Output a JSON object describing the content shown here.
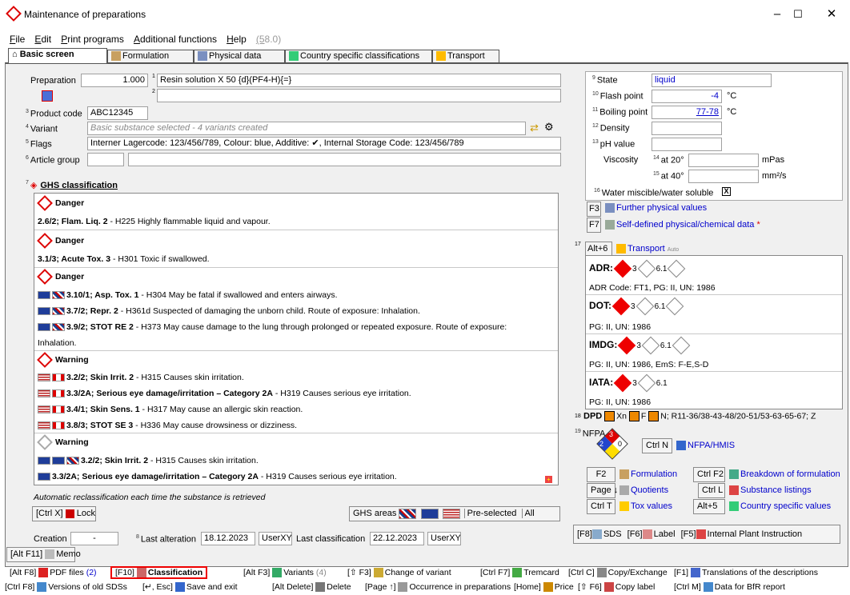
{
  "window": {
    "title": "Maintenance of preparations",
    "min": "–",
    "max": "☐",
    "close": "✕"
  },
  "menu": {
    "items": [
      "File",
      "Edit",
      "Print programs",
      "Additional functions",
      "Help"
    ],
    "version": "(58.0)"
  },
  "tabs": [
    "Basic screen",
    "Formulation",
    "Physical data",
    "Country specific classifications",
    "Transport"
  ],
  "form": {
    "preparation_label": "Preparation",
    "preparation_value": "1.000",
    "name1": "Resin solution X 50 {d}(PF4-H){=}",
    "name2": "",
    "product_code_label": "Product code",
    "product_code": "ABC12345",
    "variant_label": "Variant",
    "variant_value": "Basic substance selected - 4 variants created",
    "flags_label": "Flags",
    "flags_value": "Interner Lagercode: 123/456/789, Colour: blue, Additive: ✔, Internal Storage Code: 123/456/789",
    "article_group_label": "Article group",
    "ghs_heading": "GHS classification",
    "auto_reclass": "Automatic reclassification each time the substance is retrieved",
    "lock_shortcut": "[Ctrl X]",
    "lock_label": "Lock",
    "ghs_areas": "GHS areas",
    "preselected": "Pre-selected",
    "all": "All",
    "creation_label": "Creation",
    "creation_value": "-",
    "last_alteration_label": "Last alteration",
    "last_alteration_date": "18.12.2023",
    "last_alteration_user": "UserXY",
    "last_classification_label": "Last classification",
    "last_classification_date": "22.12.2023",
    "last_classification_user": "UserXY",
    "memo_shortcut": "[Alt F11]",
    "memo_label": "Memo"
  },
  "ghs": [
    {
      "signal": "Danger",
      "lines": [
        {
          "flags": [],
          "code": "2.6/2; Flam. Liq. 2",
          "text": " - H225 Highly flammable liquid and vapour."
        }
      ]
    },
    {
      "signal": "Danger",
      "lines": [
        {
          "flags": [],
          "code": "3.1/3; Acute Tox. 3",
          "text": " - H301 Toxic if swallowed."
        }
      ]
    },
    {
      "signal": "Danger",
      "lines": [
        {
          "flags": [
            "eu",
            "uk"
          ],
          "code": "3.10/1; Asp. Tox. 1",
          "text": " - H304 May be fatal if swallowed and enters airways."
        },
        {
          "flags": [
            "eu",
            "uk"
          ],
          "code": "3.7/2; Repr. 2",
          "text": " - H361d Suspected of damaging the unborn child. Route of exposure: Inhalation."
        },
        {
          "flags": [
            "eu",
            "uk"
          ],
          "code": "3.9/2; STOT RE 2",
          "text": " - H373 May cause damage to the lung through prolonged or repeated exposure. Route of exposure:"
        },
        {
          "flags": [],
          "code": "",
          "text": "Inhalation."
        }
      ]
    },
    {
      "signal": "Warning",
      "lines": [
        {
          "flags": [
            "us",
            "ca"
          ],
          "code": "3.2/2; Skin Irrit. 2",
          "text": " - H315 Causes skin irritation."
        },
        {
          "flags": [
            "us",
            "ca"
          ],
          "code": "3.3/2A; Serious eye damage/irritation – Category 2A",
          "text": " - H319 Causes serious eye irritation."
        },
        {
          "flags": [
            "us",
            "ca"
          ],
          "code": "3.4/1; Skin Sens. 1",
          "text": " - H317 May cause an allergic skin reaction."
        },
        {
          "flags": [
            "us",
            "ca"
          ],
          "code": "3.8/3; STOT SE 3",
          "text": " - H336 May cause drowsiness or dizziness."
        }
      ]
    },
    {
      "signal": "Warning",
      "lines": [
        {
          "flags": [
            "eu",
            "eu",
            "uk"
          ],
          "code": "3.2/2; Skin Irrit. 2",
          "text": " - H315 Causes skin irritation."
        },
        {
          "flags": [
            "eu"
          ],
          "code": "3.3/2A; Serious eye damage/irritation – Category 2A",
          "text": " - H319 Causes serious eye irritation."
        }
      ]
    }
  ],
  "physical": {
    "state_label": "State",
    "state": "liquid",
    "flash_label": "Flash point",
    "flash": "-4",
    "flash_unit": "°C",
    "boiling_label": "Boiling point",
    "boiling": "77-78",
    "boiling_unit": "°C",
    "density_label": "Density",
    "ph_label": "pH value",
    "viscosity_label": "Viscosity",
    "at20": "at 20°",
    "unit20": "mPas",
    "at40": "at 40°",
    "unit40": "mm²/s",
    "miscible_label": "Water miscible/water soluble",
    "miscible_mark": "X",
    "f3": "F3",
    "further": "Further physical values",
    "f7": "F7",
    "selfdefined": "Self-defined physical/chemical data",
    "asterisk": "*"
  },
  "transport": {
    "shortcut": "Alt+6",
    "label": "Transport",
    "auto": "Auto",
    "rows": [
      {
        "name": "ADR:",
        "n1": "3",
        "n2": "6.1",
        "detail": "ADR Code: FT1, PG: II, UN: 1986"
      },
      {
        "name": "DOT:",
        "n1": "3",
        "n2": "6.1",
        "detail": "PG: II, UN: 1986"
      },
      {
        "name": "IMDG:",
        "n1": "3",
        "n2": "6.1",
        "detail": "PG: II, UN: 1986, EmS: F-E,S-D"
      },
      {
        "name": "IATA:",
        "n1": "3",
        "n2": "6.1",
        "detail": "PG: II, UN: 1986"
      }
    ],
    "dpd_label": "DPD",
    "dpd_xn": "Xn",
    "dpd_f": "F",
    "dpd_text": "N; R11-36/38-43-48/20-51/53-63-65-67; Z",
    "nfpa_label": "NFPA",
    "nfpa_health": "2",
    "nfpa_fire": "3",
    "nfpa_react": "0",
    "nfpa_shortcut": "Ctrl N",
    "nfpa_link": "NFPA/HMIS"
  },
  "shortcuts": [
    {
      "key": "F2",
      "label": "Formulation"
    },
    {
      "key": "Ctrl F2",
      "label": "Breakdown of formulation"
    },
    {
      "key": "Page ↓",
      "label": "Quotients"
    },
    {
      "key": "Ctrl L",
      "label": "Substance listings"
    },
    {
      "key": "Ctrl T",
      "label": "Tox values"
    },
    {
      "key": "Alt+5",
      "label": "Country specific values"
    }
  ],
  "docs": {
    "sds_key": "[F8]",
    "sds": "SDS",
    "label_key": "[F6]",
    "label": "Label",
    "plant_key": "[F5]",
    "plant": "Internal Plant Instruction"
  },
  "bottom1": [
    {
      "key": "[Alt F8]",
      "label": "PDF files",
      "count": "(2)"
    },
    {
      "key": "[F10]",
      "label": "Classification",
      "count": ""
    },
    {
      "key": "[Alt F3]",
      "label": "Variants",
      "count": "(4)"
    },
    {
      "key": "[⇧ F3]",
      "label": "Change of variant",
      "count": ""
    },
    {
      "key": "[Ctrl F7]",
      "label": "Tremcard",
      "count": ""
    },
    {
      "key": "[Ctrl C]",
      "label": "Copy/Exchange",
      "count": ""
    },
    {
      "key": "[F1]",
      "label": "Translations of the descriptions",
      "count": ""
    }
  ],
  "bottom2": [
    {
      "key": "[Ctrl F8]",
      "label": "Versions of old SDSs"
    },
    {
      "key": "[↵, Esc]",
      "label": "Save and exit"
    },
    {
      "key": "[Alt Delete]",
      "label": "Delete"
    },
    {
      "key": "[Page ↑]",
      "label": "Occurrence in preparations"
    },
    {
      "key": "[Home]",
      "label": "Price"
    },
    {
      "key": "[⇧ F6]",
      "label": "Copy label"
    },
    {
      "key": "[Ctrl M]",
      "label": "Data for BfR report"
    }
  ],
  "colors": {
    "accent": "#0000cc",
    "danger": "#dd0000",
    "highlight": "#e00000"
  }
}
